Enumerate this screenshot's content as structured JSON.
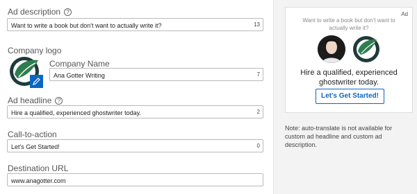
{
  "form": {
    "ad_description": {
      "label": "Ad description",
      "value": "Want to write a book but don't want to actually write it?",
      "count": "13"
    },
    "company_logo": {
      "label": "Company logo"
    },
    "company_name": {
      "label": "Company Name",
      "value": "Ana Gotter Writing",
      "count": "7"
    },
    "ad_headline": {
      "label": "Ad headline",
      "value": "Hire a qualified, experienced ghostwriter today.",
      "count": "2"
    },
    "call_to_action": {
      "label": "Call-to-action",
      "value": "Let's Get Started!",
      "count": "0"
    },
    "destination_url": {
      "label": "Destination URL",
      "value": "www.anagotter.com"
    }
  },
  "preview": {
    "ad_tag": "Ad",
    "description": "Want to write a book but don't want to actually write it?",
    "headline": "Hire a qualified, experienced ghostwriter today.",
    "cta_label": "Let's Get Started!"
  },
  "note": "Note: auto-translate is not available for custom ad headline and custom ad description.",
  "colors": {
    "accent": "#0a66c2",
    "logo_green": "#2f7d4f",
    "logo_dark": "#1f3b3a"
  },
  "icons": {
    "help": "help-circle-icon",
    "edit": "pencil-icon"
  }
}
